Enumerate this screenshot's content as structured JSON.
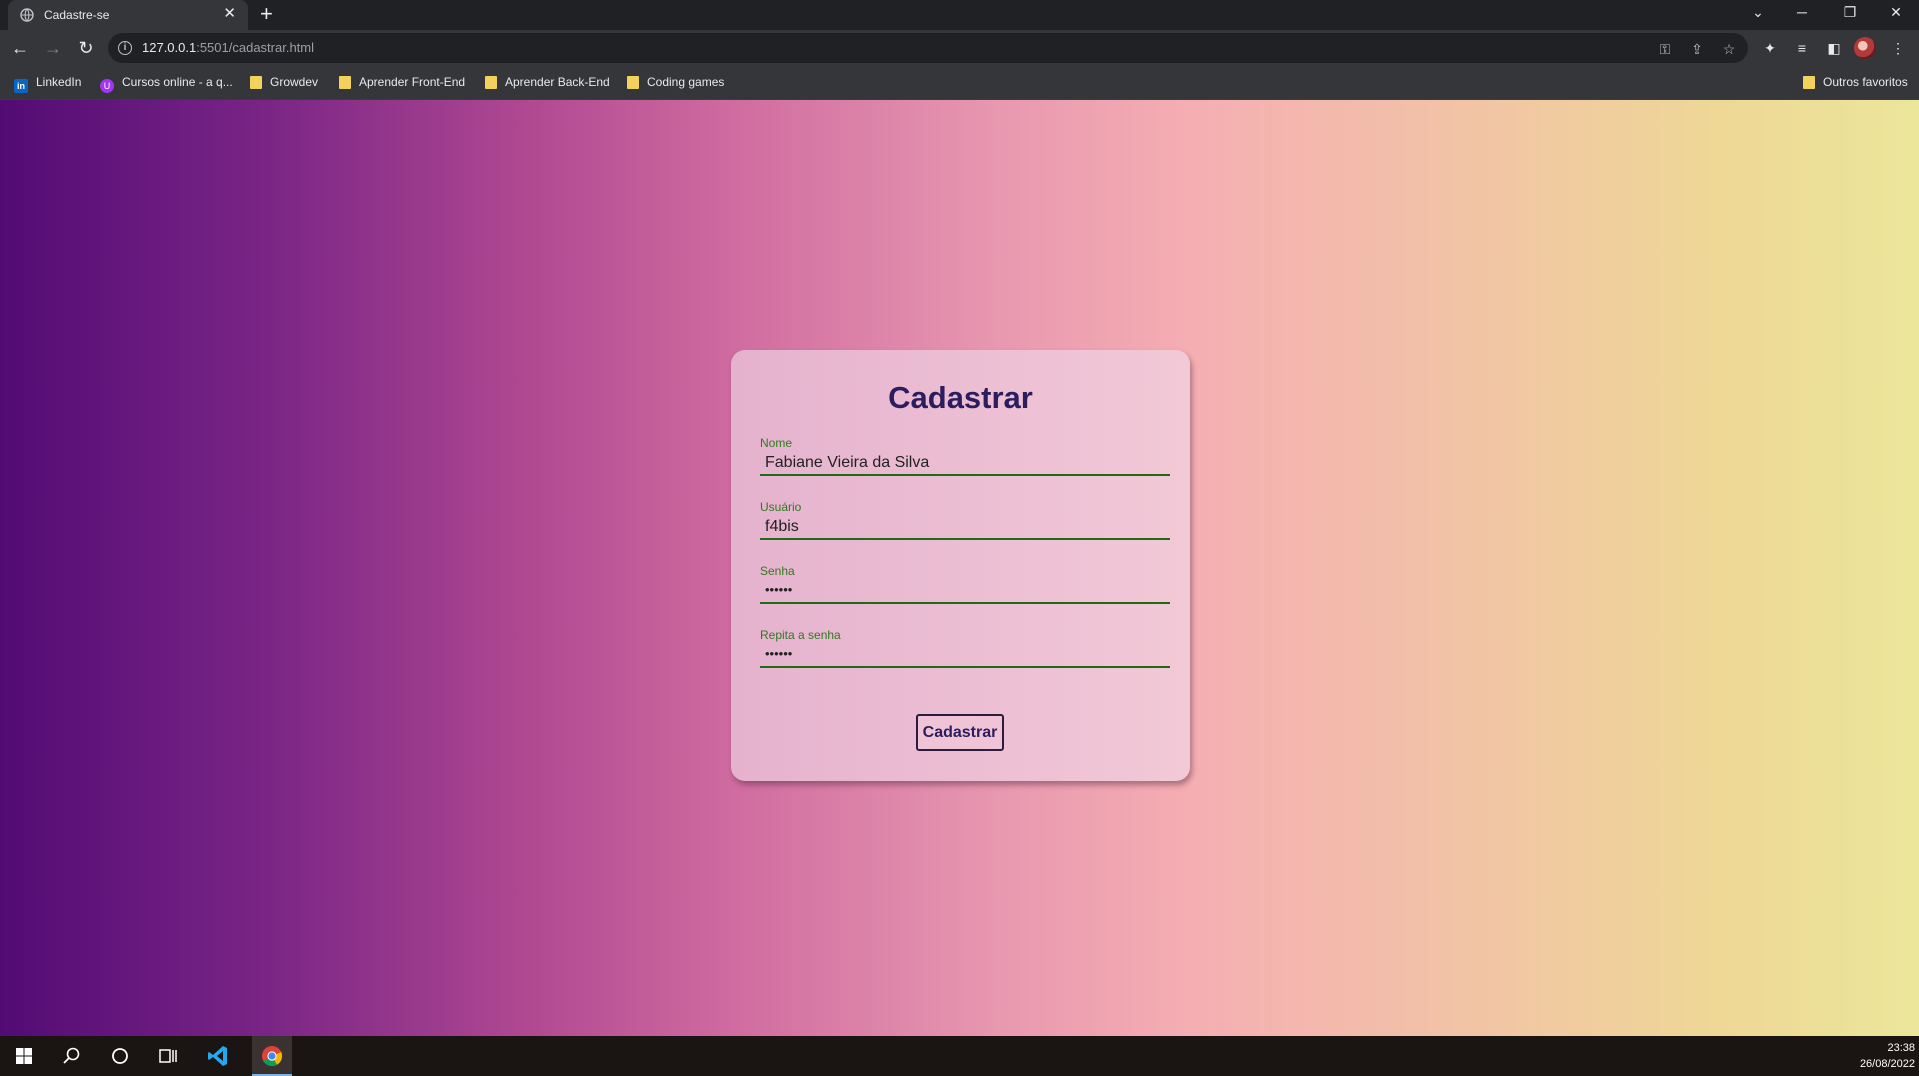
{
  "browser": {
    "tab_title": "Cadastre-se",
    "tab_close": "✕",
    "new_tab": "+",
    "url_host": "127.0.0.1",
    "url_rest": ":5501/cadastrar.html",
    "window_controls": [
      "⌄",
      "─",
      "❐",
      "✕"
    ]
  },
  "bookmarks": [
    {
      "label": "LinkedIn",
      "icon": "linkedin-icon"
    },
    {
      "label": "Cursos online - a q...",
      "icon": "udemy-icon"
    },
    {
      "label": "Growdev",
      "icon": "folder-icon"
    },
    {
      "label": "Aprender Front-End",
      "icon": "folder-icon"
    },
    {
      "label": "Aprender Back-End",
      "icon": "folder-icon"
    },
    {
      "label": "Coding games",
      "icon": "folder-icon"
    }
  ],
  "other_bookmarks": "Outros favoritos",
  "form": {
    "title": "Cadastrar",
    "fields": [
      {
        "label": "Nome",
        "value": "Fabiane Vieira da Silva"
      },
      {
        "label": "Usuário",
        "value": "f4bis"
      },
      {
        "label": "Senha",
        "value": "••••••"
      },
      {
        "label": "Repita a senha",
        "value": "••••••"
      }
    ],
    "submit_label": "Cadastrar"
  },
  "taskbar": {
    "time": "23:38",
    "date": "26/08/2022"
  },
  "colors": {
    "card_title": "#2b1d5e",
    "field_label": "#2f7a1c",
    "field_underline": "#1f6a12"
  }
}
